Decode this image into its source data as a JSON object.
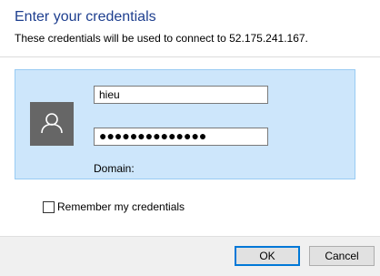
{
  "dialog": {
    "title": "Enter your credentials",
    "subtitle": "These credentials will be used to connect to 52.175.241.167."
  },
  "credential": {
    "avatar_icon": "user-icon",
    "username_value": "hieu",
    "password_mask": "●●●●●●●●●●●●●●",
    "domain_label": "Domain:"
  },
  "options": {
    "remember_label": "Remember my credentials",
    "remember_checked": false
  },
  "buttons": {
    "ok_label": "OK",
    "cancel_label": "Cancel"
  },
  "colors": {
    "title": "#1e3f8f",
    "tile_background": "#cde6fb",
    "tile_border": "#99cbf3",
    "avatar_background": "#666666",
    "default_button_border": "#0078d7"
  }
}
